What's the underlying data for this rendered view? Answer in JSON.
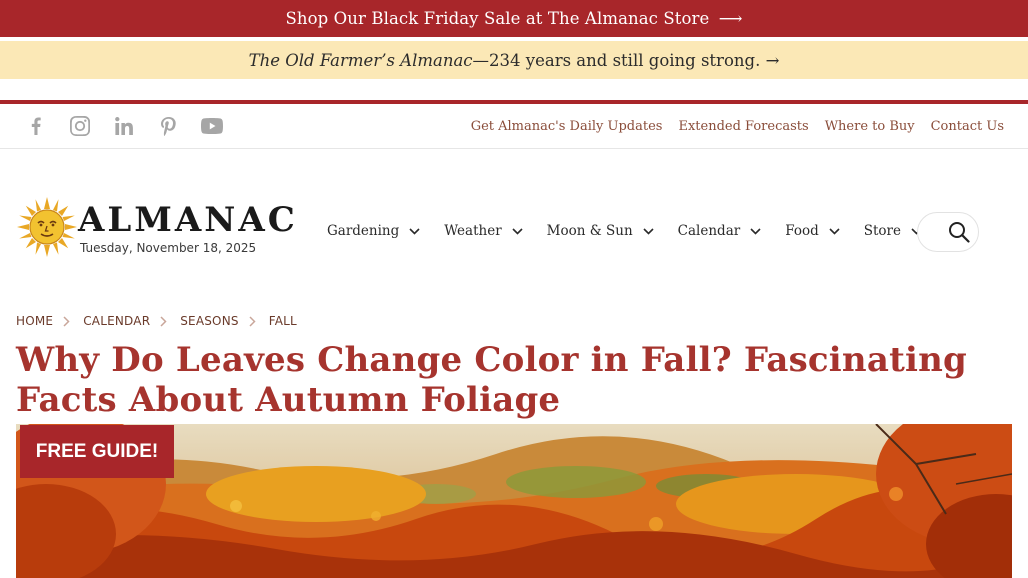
{
  "promo": {
    "text": "Shop Our Black Friday Sale at The Almanac Store",
    "arrow": "⟶"
  },
  "tagline": {
    "title": "The Old Farmer’s Almanac",
    "rest": "—234 years and still going strong.",
    "arrow": "→"
  },
  "social": {
    "icons": [
      "facebook-icon",
      "instagram-icon",
      "linkedin-icon",
      "pinterest-icon",
      "youtube-icon"
    ]
  },
  "utility_links": [
    "Get Almanac's Daily Updates",
    "Extended Forecasts",
    "Where to Buy",
    "Contact Us"
  ],
  "logo": {
    "wordmark": "ALMANAC",
    "date": "Tuesday, November 18, 2025"
  },
  "nav": [
    "Gardening",
    "Weather",
    "Moon & Sun",
    "Calendar",
    "Food",
    "Store"
  ],
  "breadcrumb": [
    "HOME",
    "CALENDAR",
    "SEASONS",
    "FALL"
  ],
  "article": {
    "title": "Why Do Leaves Change Color in Fall? Fascinating Facts About Autumn Foliage"
  },
  "cta": {
    "free_guide": "FREE GUIDE!"
  },
  "colors": {
    "brand_red": "#a8262a",
    "tagline_bg": "#fbe8b6",
    "title_red": "#a6342e",
    "link_brown": "#8a4d3a"
  }
}
